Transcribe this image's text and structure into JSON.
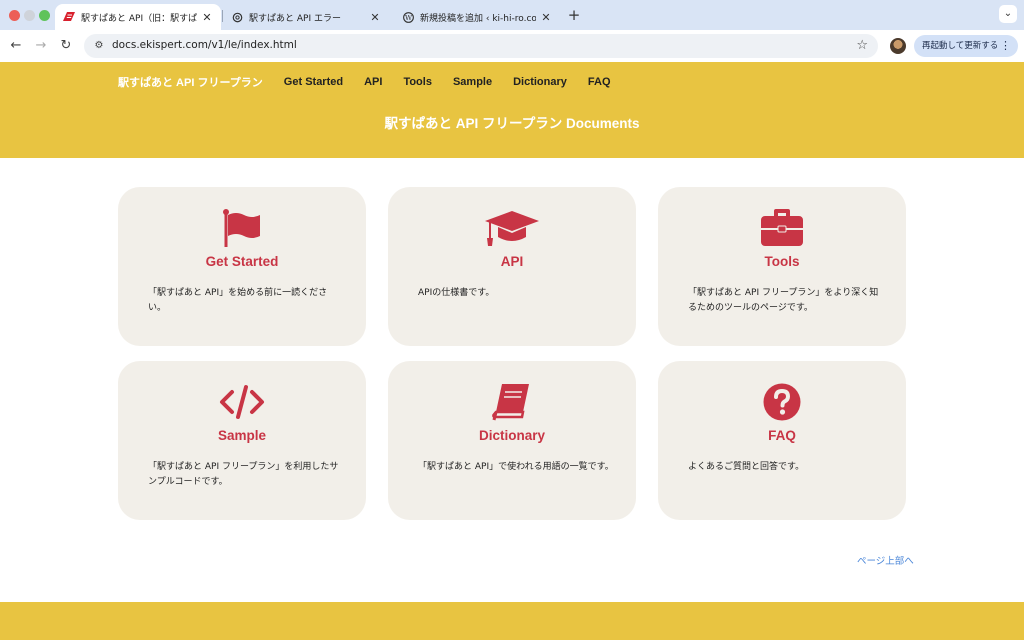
{
  "browser": {
    "tabs": [
      {
        "title": "駅すぱあと API（旧：駅すぱあと",
        "active": true,
        "favicon": "ekispert-logo-icon"
      },
      {
        "title": "駅すぱあと API エラー",
        "active": false,
        "favicon": "openai-icon"
      },
      {
        "title": "新規投稿を追加 ‹ ki-hi-ro.com",
        "active": false,
        "favicon": "wordpress-icon"
      }
    ],
    "new_tab_label": "+",
    "url": "docs.ekispert.com/v1/le/index.html",
    "relaunch_label": "再起動して更新する"
  },
  "header": {
    "nav": [
      {
        "label": "駅すぱあと API フリープラン",
        "brand": true
      },
      {
        "label": "Get Started"
      },
      {
        "label": "API"
      },
      {
        "label": "Tools"
      },
      {
        "label": "Sample"
      },
      {
        "label": "Dictionary"
      },
      {
        "label": "FAQ"
      }
    ],
    "title": "駅すぱあと API フリープラン Documents"
  },
  "cards": [
    {
      "title": "Get Started",
      "icon": "flag-icon",
      "description": "「駅すぱあと API」を始める前に一読ください。"
    },
    {
      "title": "API",
      "icon": "graduation-cap-icon",
      "description": "APIの仕様書です。"
    },
    {
      "title": "Tools",
      "icon": "toolbox-icon",
      "description": "「駅すぱあと API フリープラン」をより深く知るためのツールのページです。"
    },
    {
      "title": "Sample",
      "icon": "code-icon",
      "description": "「駅すぱあと API フリープラン」を利用したサンプルコードです。"
    },
    {
      "title": "Dictionary",
      "icon": "book-icon",
      "description": "「駅すぱあと API」で使われる用語の一覧です。"
    },
    {
      "title": "FAQ",
      "icon": "question-circle-icon",
      "description": "よくあるご質問と回答です。"
    }
  ],
  "back_to_top": "ページ上部へ",
  "colors": {
    "accent": "#c83545",
    "header_bg": "#e8c441",
    "card_bg": "#f2efe9",
    "link": "#4a86d8"
  }
}
